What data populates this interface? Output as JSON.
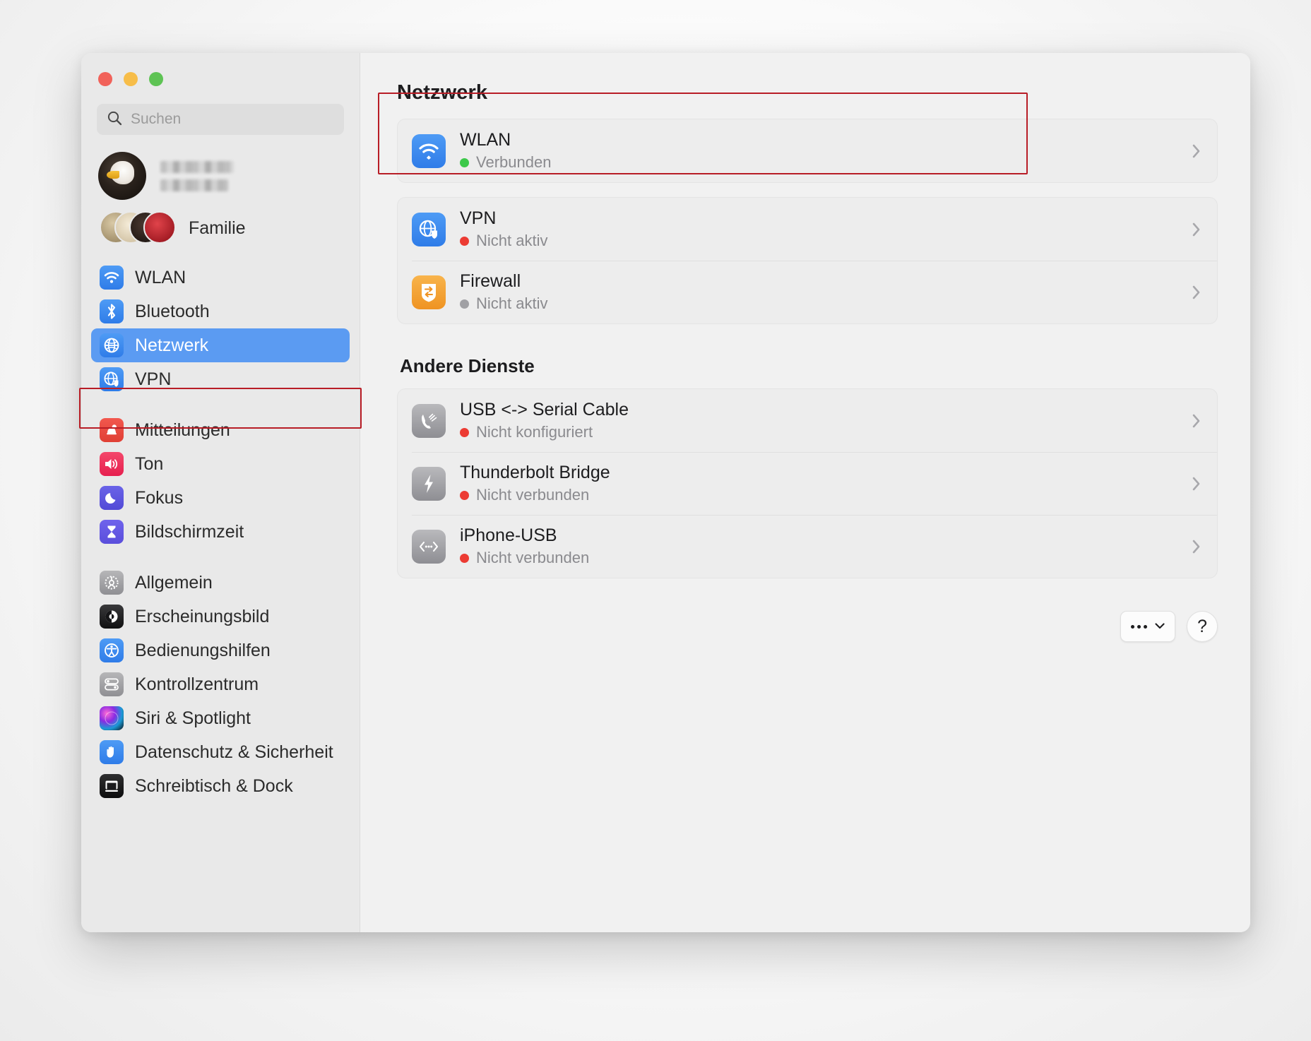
{
  "window": {
    "traffic_lights": [
      "close",
      "minimize",
      "maximize"
    ]
  },
  "search": {
    "placeholder": "Suchen",
    "value": "",
    "icon": "search-icon"
  },
  "account": {
    "name_redacted": true,
    "family_label": "Familie"
  },
  "sidebar": {
    "groups": [
      {
        "items": [
          {
            "label": "WLAN",
            "icon": "wifi-icon",
            "selected": false
          },
          {
            "label": "Bluetooth",
            "icon": "bluetooth-icon",
            "selected": false
          },
          {
            "label": "Netzwerk",
            "icon": "globe-icon",
            "selected": true
          },
          {
            "label": "VPN",
            "icon": "vpn-globe-icon",
            "selected": false
          }
        ]
      },
      {
        "items": [
          {
            "label": "Mitteilungen",
            "icon": "bell-icon",
            "selected": false
          },
          {
            "label": "Ton",
            "icon": "speaker-icon",
            "selected": false
          },
          {
            "label": "Fokus",
            "icon": "moon-icon",
            "selected": false
          },
          {
            "label": "Bildschirmzeit",
            "icon": "hourglass-icon",
            "selected": false
          }
        ]
      },
      {
        "items": [
          {
            "label": "Allgemein",
            "icon": "gear-icon",
            "selected": false
          },
          {
            "label": "Erscheinungsbild",
            "icon": "appearance-icon",
            "selected": false
          },
          {
            "label": "Bedienungshilfen",
            "icon": "accessibility-icon",
            "selected": false
          },
          {
            "label": "Kontrollzentrum",
            "icon": "sliders-icon",
            "selected": false
          },
          {
            "label": "Siri & Spotlight",
            "icon": "siri-icon",
            "selected": false
          },
          {
            "label": "Datenschutz & Sicherheit",
            "icon": "hand-icon",
            "selected": false
          },
          {
            "label": "Schreibtisch & Dock",
            "icon": "dock-icon",
            "selected": false
          }
        ]
      }
    ]
  },
  "main": {
    "title": "Netzwerk",
    "section_title": "Andere Dienste",
    "primary_services": [
      {
        "name": "WLAN",
        "status": "Verbunden",
        "status_color": "#3cc84a",
        "icon": "wifi-icon",
        "chevron": "chevron-right-icon"
      },
      {
        "name": "VPN",
        "status": "Nicht aktiv",
        "status_color": "#ec3b33",
        "icon": "vpn-globe-icon",
        "chevron": "chevron-right-icon"
      },
      {
        "name": "Firewall",
        "status": "Nicht aktiv",
        "status_color": "#a0a0a4",
        "icon": "firewall-icon",
        "chevron": "chevron-right-icon"
      }
    ],
    "other_services": [
      {
        "name": "USB <-> Serial Cable",
        "status": "Nicht konfiguriert",
        "status_color": "#ec3b33",
        "icon": "modem-phone-icon",
        "chevron": "chevron-right-icon"
      },
      {
        "name": "Thunderbolt Bridge",
        "status": "Nicht verbunden",
        "status_color": "#ec3b33",
        "icon": "thunderbolt-icon",
        "chevron": "chevron-right-icon"
      },
      {
        "name": "iPhone-USB",
        "status": "Nicht verbunden",
        "status_color": "#ec3b33",
        "icon": "iphone-usb-icon",
        "chevron": "chevron-right-icon"
      }
    ],
    "buttons": {
      "more_label": "",
      "help_label": "?"
    }
  },
  "annotations": {
    "highlight_color": "#b81d26",
    "targets": [
      "sidebar-item-netzwerk",
      "service-row-wlan"
    ]
  }
}
